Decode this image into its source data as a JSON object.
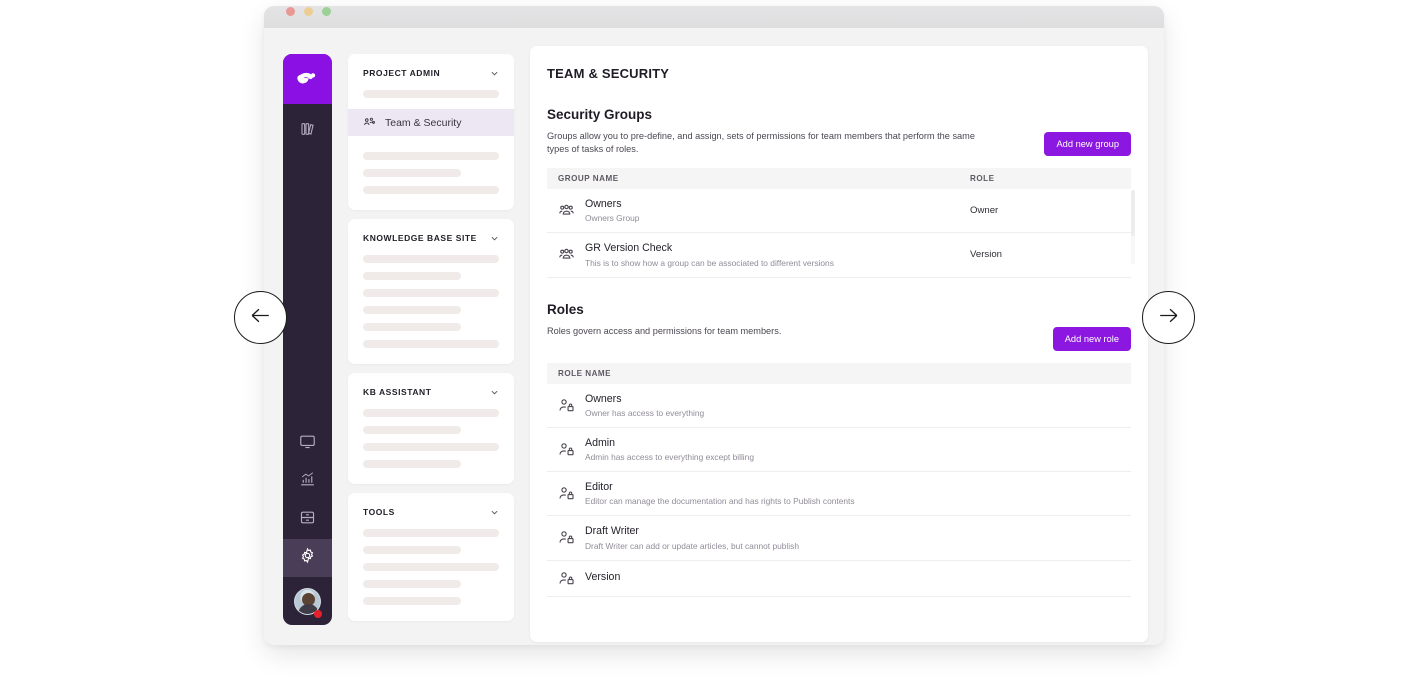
{
  "window": {
    "traffic_lights": [
      "#f05c54",
      "#f5bd4f",
      "#61c454"
    ]
  },
  "rail": {
    "logo_name": "document360-logo",
    "items": [
      {
        "icon": "books-icon",
        "name": "rail-item-knowledge-base",
        "active": false
      },
      {
        "icon": "monitor-icon",
        "name": "rail-item-site",
        "active": false
      },
      {
        "icon": "analytics-icon",
        "name": "rail-item-analytics",
        "active": false
      },
      {
        "icon": "drawer-icon",
        "name": "rail-item-drive",
        "active": false
      },
      {
        "icon": "gear-icon",
        "name": "rail-item-settings",
        "active": true
      }
    ],
    "avatar_name": "user-avatar",
    "notification_badge": true
  },
  "sidebar": {
    "sections": [
      {
        "title": "PROJECT ADMIN",
        "skeletons_before": [
          1
        ],
        "active_item": {
          "label": "Team & Security",
          "icon": "group-icon"
        },
        "skeletons_after": [
          100,
          72,
          100
        ]
      },
      {
        "title": "KNOWLEDGE BASE SITE",
        "skeletons": [
          100,
          72,
          100,
          72,
          72,
          100
        ]
      },
      {
        "title": "KB ASSISTANT",
        "skeletons": [
          100,
          72,
          100,
          72
        ]
      },
      {
        "title": "TOOLS",
        "skeletons": [
          100,
          72,
          100,
          72,
          72
        ]
      }
    ]
  },
  "main": {
    "page_title": "TEAM & SECURITY",
    "security_groups": {
      "title": "Security Groups",
      "description": "Groups allow you to pre-define, and assign, sets of permissions for team members that perform the same types of tasks of roles.",
      "button_label": "Add new group",
      "columns": [
        "GROUP NAME",
        "ROLE"
      ],
      "rows": [
        {
          "name": "Owners",
          "description": "Owners Group",
          "role": "Owner",
          "icon": "group-icon"
        },
        {
          "name": "GR Version Check",
          "description": "This is to show how a group can be associated to different versions",
          "role": "Version",
          "icon": "group-icon"
        }
      ]
    },
    "roles": {
      "title": "Roles",
      "description": "Roles govern access and permissions for team members.",
      "button_label": "Add new role",
      "columns": [
        "ROLE NAME"
      ],
      "rows": [
        {
          "name": "Owners",
          "description": "Owner has access to everything",
          "icon": "person-lock-icon"
        },
        {
          "name": "Admin",
          "description": "Admin has access to everything except billing",
          "icon": "person-lock-icon"
        },
        {
          "name": "Editor",
          "description": "Editor can manage the documentation and has rights to Publish contents",
          "icon": "person-lock-icon"
        },
        {
          "name": "Draft Writer",
          "description": "Draft Writer can add or update articles, but cannot publish",
          "icon": "person-lock-icon"
        },
        {
          "name": "Version",
          "description": "",
          "icon": "person-lock-icon"
        }
      ]
    }
  },
  "carousel": {
    "prev_icon": "arrow-left-icon",
    "next_icon": "arrow-right-icon"
  },
  "colors": {
    "brand_purple": "#8B17E0",
    "rail_dark": "#2d2338",
    "active_nav": "#ede7f4",
    "badge_red": "#e8202a"
  }
}
